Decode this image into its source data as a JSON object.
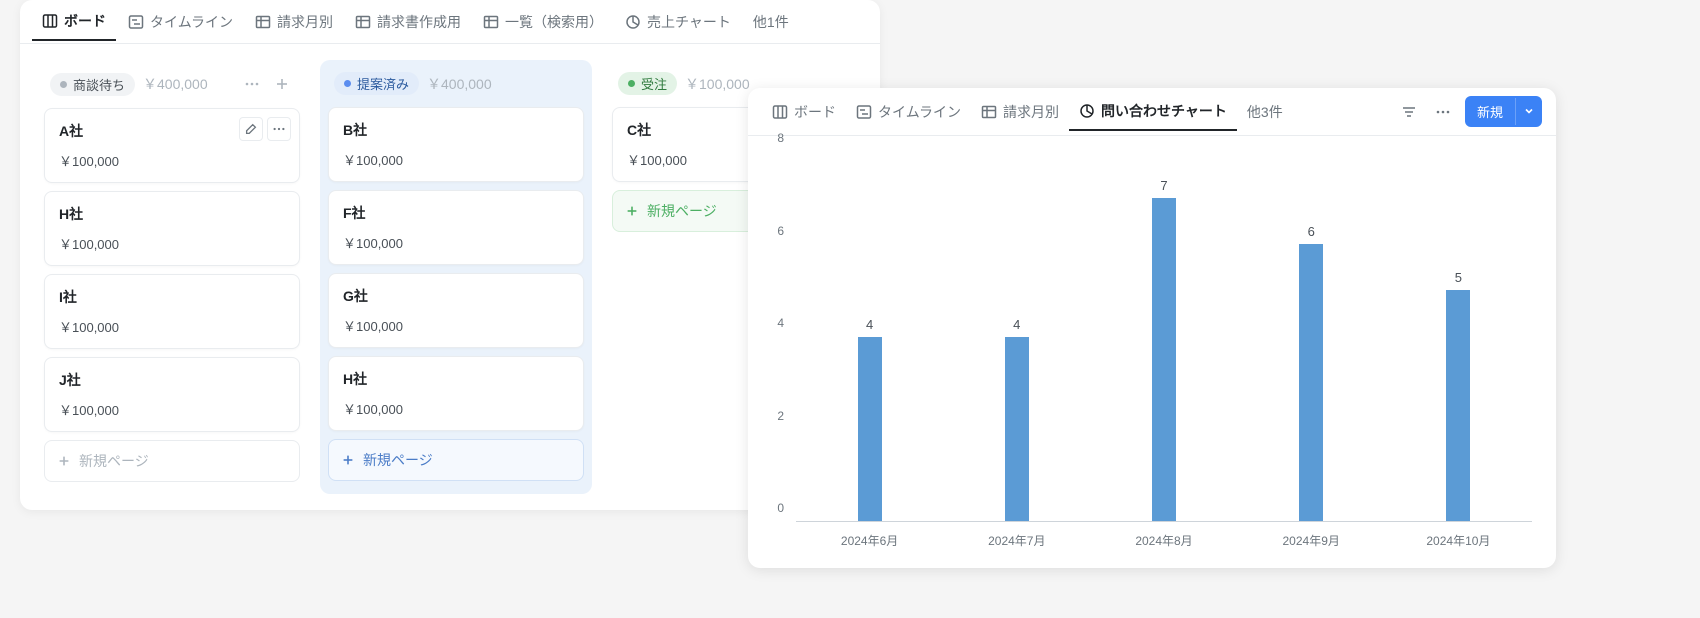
{
  "board": {
    "tabs": [
      {
        "label": "ボード",
        "icon": "board"
      },
      {
        "label": "タイムライン",
        "icon": "timeline"
      },
      {
        "label": "請求月別",
        "icon": "table"
      },
      {
        "label": "請求書作成用",
        "icon": "table"
      },
      {
        "label": "一覧（検索用）",
        "icon": "table"
      },
      {
        "label": "売上チャート",
        "icon": "chart"
      }
    ],
    "more_label": "他1件",
    "columns": [
      {
        "name": "商談待ち",
        "badge_class": "badge-gray",
        "total": "￥400,000",
        "show_actions": true,
        "cards": [
          {
            "title": "A社",
            "amount": "￥100,000",
            "hover": true
          },
          {
            "title": "H社",
            "amount": "￥100,000"
          },
          {
            "title": "I社",
            "amount": "￥100,000"
          },
          {
            "title": "J社",
            "amount": "￥100,000"
          }
        ],
        "new_page": "新規ページ",
        "new_page_style": "muted"
      },
      {
        "name": "提案済み",
        "badge_class": "badge-blue",
        "total": "￥400,000",
        "highlighted": true,
        "cards": [
          {
            "title": "B社",
            "amount": "￥100,000"
          },
          {
            "title": "F社",
            "amount": "￥100,000"
          },
          {
            "title": "G社",
            "amount": "￥100,000"
          },
          {
            "title": "H社",
            "amount": "￥100,000"
          }
        ],
        "new_page": "新規ページ",
        "new_page_style": "blue"
      },
      {
        "name": "受注",
        "badge_class": "badge-green",
        "total": "￥100,000",
        "cards": [
          {
            "title": "C社",
            "amount": "￥100,000"
          }
        ],
        "new_page": "新規ページ",
        "new_page_style": "green"
      }
    ]
  },
  "chart_panel": {
    "tabs": [
      {
        "label": "ボード",
        "icon": "board"
      },
      {
        "label": "タイムライン",
        "icon": "timeline"
      },
      {
        "label": "請求月別",
        "icon": "table"
      },
      {
        "label": "問い合わせチャート",
        "icon": "chart"
      }
    ],
    "more_label": "他3件",
    "new_button": "新規"
  },
  "chart_data": {
    "type": "bar",
    "categories": [
      "2024年6月",
      "2024年7月",
      "2024年8月",
      "2024年9月",
      "2024年10月"
    ],
    "values": [
      4,
      4,
      7,
      6,
      5
    ],
    "ylim": [
      0,
      8
    ],
    "yticks": [
      0,
      2,
      4,
      6,
      8
    ],
    "title": "",
    "xlabel": "",
    "ylabel": ""
  }
}
